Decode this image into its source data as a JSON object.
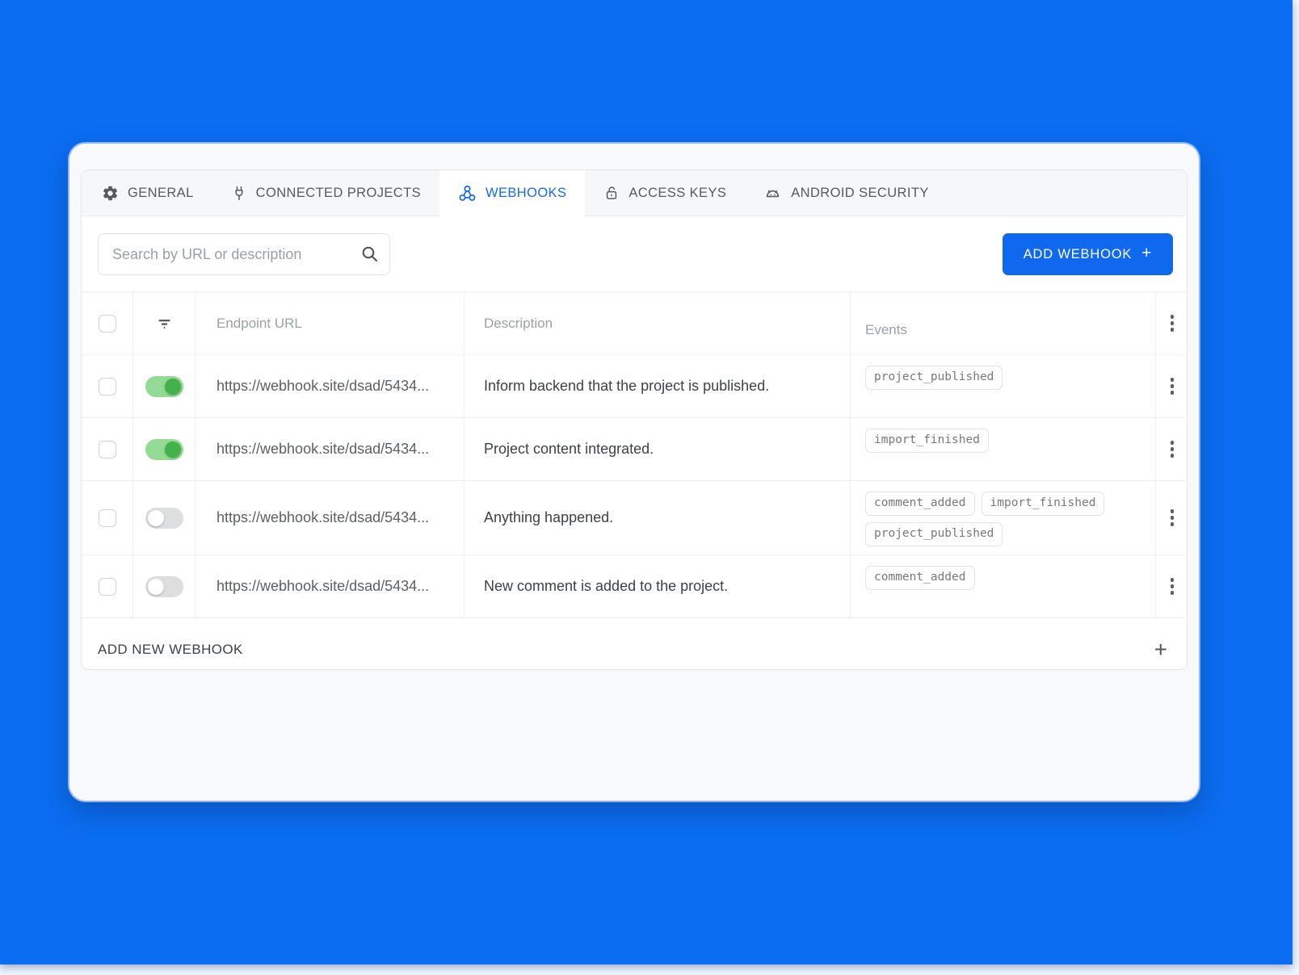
{
  "colors": {
    "page_background": "#0b6df1",
    "accent_blue": "#1068ee",
    "active_tab_blue": "#1569f0",
    "toggle_on_green": "#44b24a"
  },
  "tabs": [
    {
      "label": "GENERAL",
      "icon": "gear-icon",
      "active": false
    },
    {
      "label": "CONNECTED PROJECTS",
      "icon": "plug-icon",
      "active": false
    },
    {
      "label": "WEBHOOKS",
      "icon": "webhook-icon",
      "active": true
    },
    {
      "label": "ACCESS KEYS",
      "icon": "lock-open-icon",
      "active": false
    },
    {
      "label": "ANDROID SECURITY",
      "icon": "android-icon",
      "active": false
    }
  ],
  "toolbar": {
    "search_placeholder": "Search by URL or description",
    "add_webhook_label": "ADD WEBHOOK",
    "add_webhook_plus": "+"
  },
  "table": {
    "columns": {
      "endpoint": "Endpoint URL",
      "description": "Description",
      "events": "Events"
    },
    "rows": [
      {
        "enabled": true,
        "url": "https://webhook.site/dsad/5434...",
        "description": "Inform backend that the project is published.",
        "events": [
          "project_published"
        ]
      },
      {
        "enabled": true,
        "url": "https://webhook.site/dsad/5434...",
        "description": "Project content integrated.",
        "events": [
          "import_finished"
        ]
      },
      {
        "enabled": false,
        "url": "https://webhook.site/dsad/5434...",
        "description": "Anything happened.",
        "events": [
          "comment_added",
          "import_finished",
          "project_published"
        ]
      },
      {
        "enabled": false,
        "url": "https://webhook.site/dsad/5434...",
        "description": "New comment is added to the project.",
        "events": [
          "comment_added"
        ]
      }
    ]
  },
  "footer": {
    "add_new_label": "ADD NEW WEBHOOK",
    "plus": "+"
  }
}
